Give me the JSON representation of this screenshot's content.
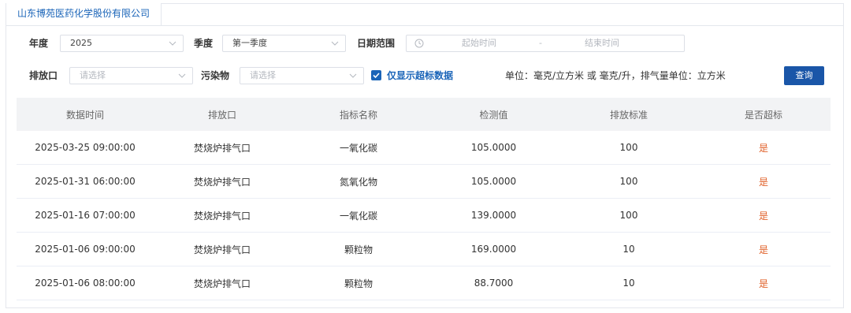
{
  "tab": {
    "label": "山东博苑医药化学股份有限公司"
  },
  "filters": {
    "year_label": "年度",
    "year_value": "2025",
    "season_label": "季度",
    "season_value": "第一季度",
    "date_label": "日期范围",
    "date_start_placeholder": "起始时间",
    "date_separator": "-",
    "date_end_placeholder": "结束时间",
    "outlet_label": "排放口",
    "outlet_placeholder": "请选择",
    "pollutant_label": "污染物",
    "pollutant_placeholder": "请选择",
    "exceed_only_label": "仅显示超标数据",
    "exceed_only_checked": true,
    "unit_note": "单位：毫克/立方米 或 毫克/升，排气量单位：立方米",
    "query_button": "查询"
  },
  "table": {
    "headers": [
      "数据时间",
      "排放口",
      "指标名称",
      "检测值",
      "排放标准",
      "是否超标"
    ],
    "rows": [
      [
        "2025-03-25 09:00:00",
        "焚烧炉排气口",
        "一氧化碳",
        "105.0000",
        "100",
        "是"
      ],
      [
        "2025-01-31 06:00:00",
        "焚烧炉排气口",
        "氮氧化物",
        "105.0000",
        "100",
        "是"
      ],
      [
        "2025-01-16 07:00:00",
        "焚烧炉排气口",
        "一氧化碳",
        "139.0000",
        "100",
        "是"
      ],
      [
        "2025-01-06 09:00:00",
        "焚烧炉排气口",
        "颗粒物",
        "169.0000",
        "10",
        "是"
      ],
      [
        "2025-01-06 08:00:00",
        "焚烧炉排气口",
        "颗粒物",
        "88.7000",
        "10",
        "是"
      ]
    ]
  },
  "colors": {
    "accent": "#1a64b8",
    "button": "#1a56a8",
    "exceed": "#e0622b",
    "header_bg": "#f2f3f5"
  }
}
